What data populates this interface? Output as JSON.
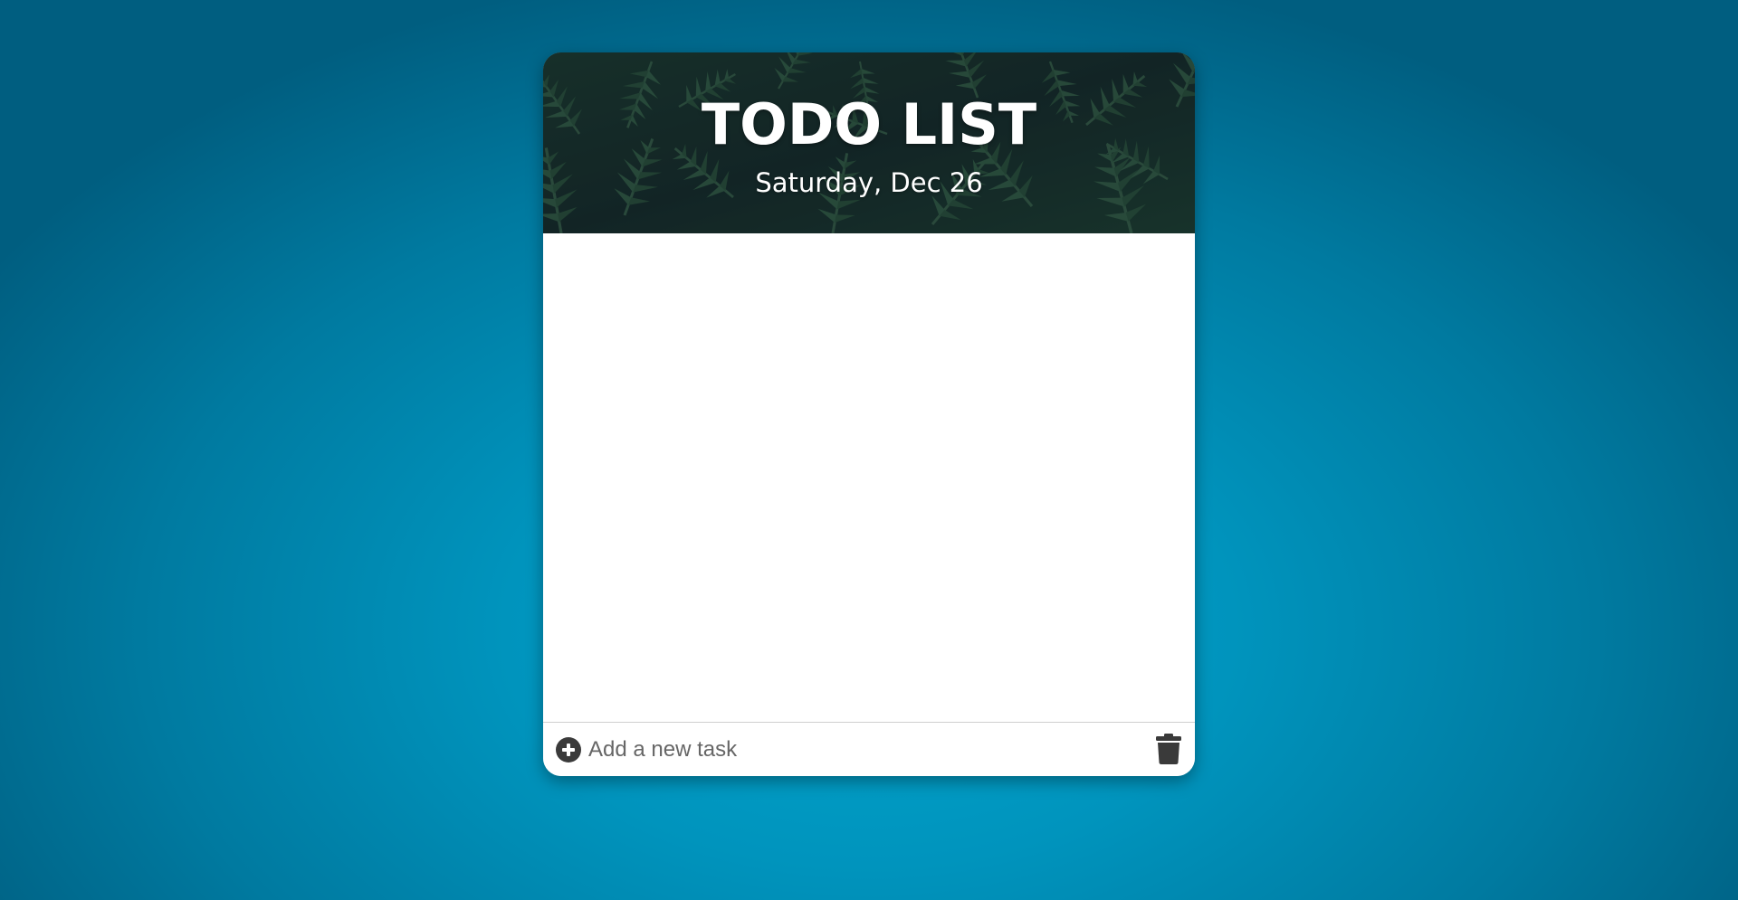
{
  "header": {
    "title": "TODO LIST",
    "date": "Saturday, Dec 26"
  },
  "todo_list": {
    "items": []
  },
  "footer": {
    "add_icon": "plus-circle-icon",
    "input_placeholder": "Add a new task",
    "input_value": "",
    "clear_icon": "trash-icon"
  },
  "colors": {
    "page_background": "#0094bd",
    "card_background": "#ffffff",
    "icon_color": "#3a3a3a",
    "header_foliage": "#17302a"
  }
}
